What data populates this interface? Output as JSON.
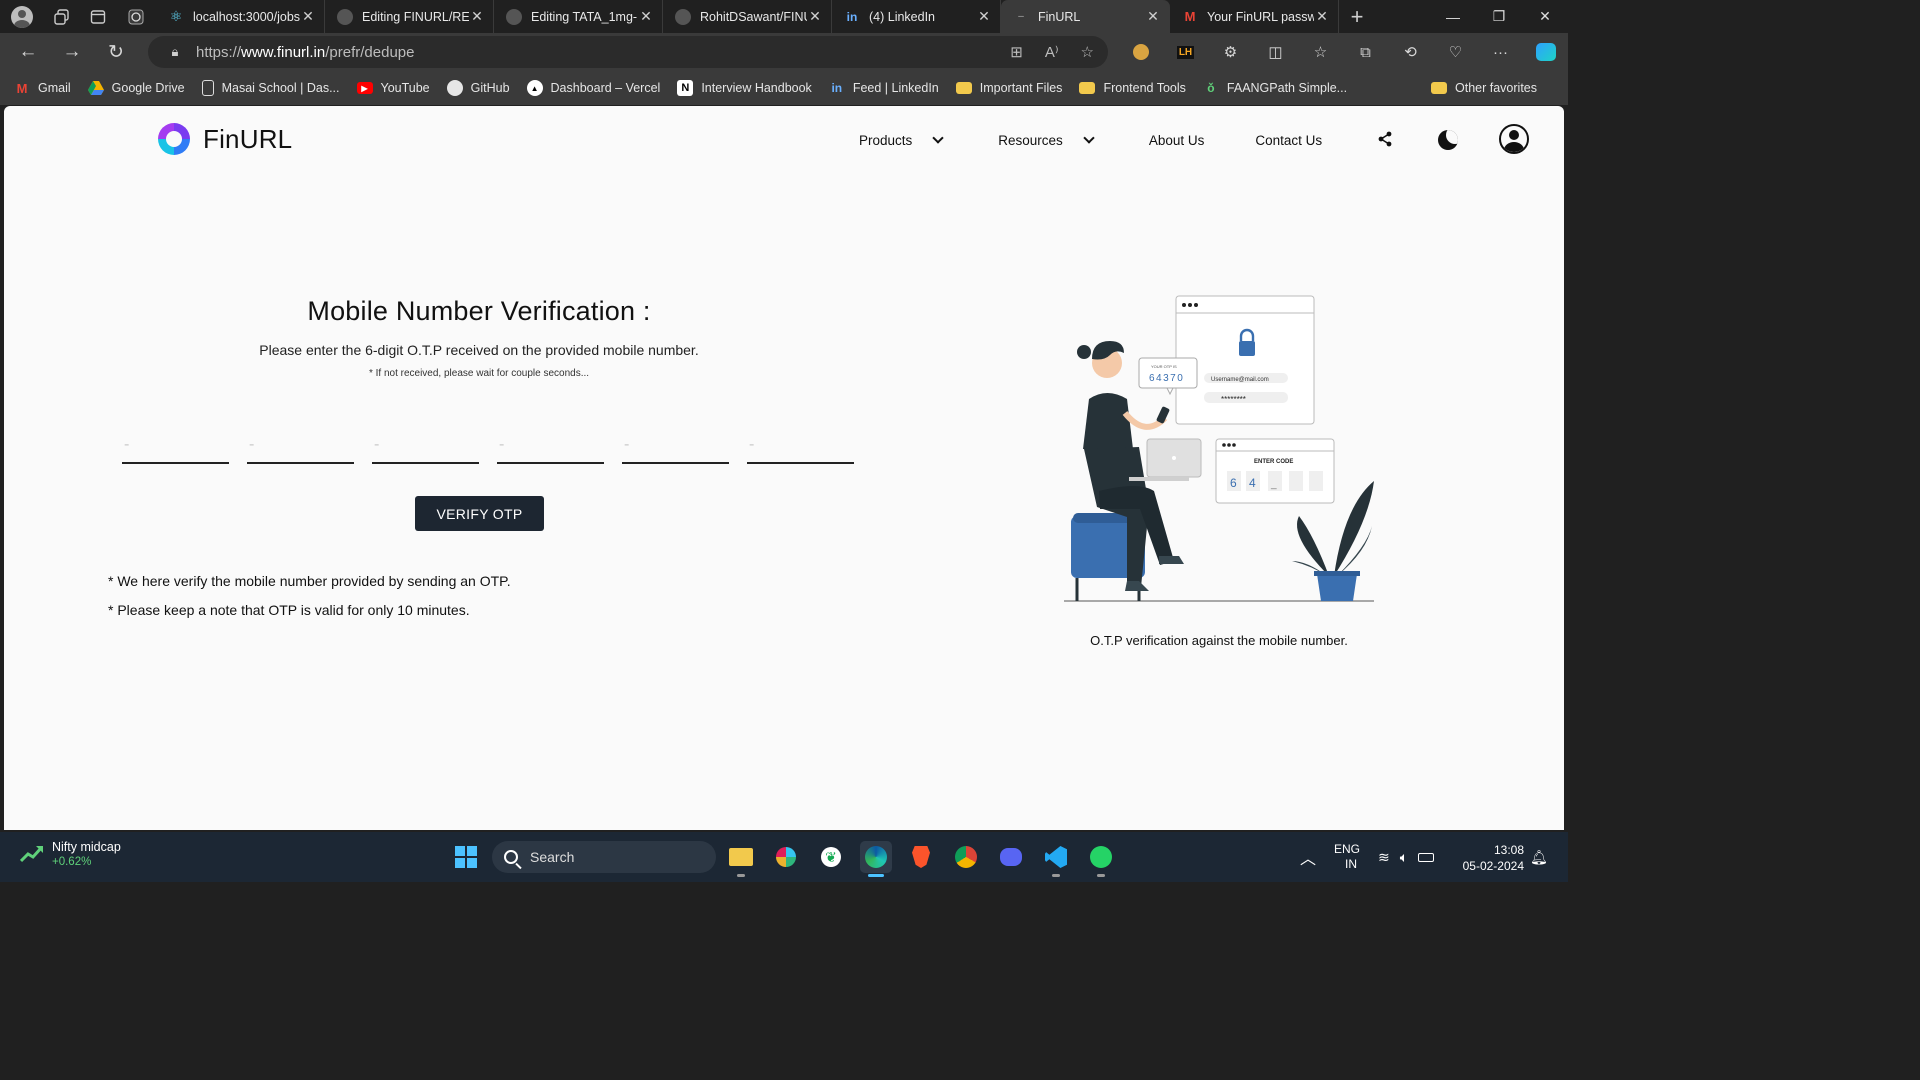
{
  "browser": {
    "tabs": [
      {
        "label": "localhost:3000/jobs",
        "icon": "react-icon",
        "active": false
      },
      {
        "label": "Editing FINURL/README",
        "icon": "github-icon",
        "active": false
      },
      {
        "label": "Editing TATA_1mg-",
        "icon": "github-icon",
        "active": false
      },
      {
        "label": "RohitDSawant/FINURL",
        "icon": "github-icon",
        "active": false
      },
      {
        "label": "(4) LinkedIn",
        "icon": "linkedin-icon",
        "active": false
      },
      {
        "label": "FinURL",
        "icon": "loading-icon",
        "active": true
      },
      {
        "label": "Your FinURL password",
        "icon": "gmail-icon",
        "active": false
      }
    ],
    "address": {
      "prefix": "https://",
      "host": "www.finurl.in",
      "path": "/prefr/dedupe"
    },
    "bookmarks": [
      {
        "label": "Gmail",
        "icon": "gmail-icon"
      },
      {
        "label": "Google Drive",
        "icon": "google-drive-icon"
      },
      {
        "label": "Masai School | Das...",
        "icon": "page-icon"
      },
      {
        "label": "YouTube",
        "icon": "youtube-icon"
      },
      {
        "label": "GitHub",
        "icon": "github-icon"
      },
      {
        "label": "Dashboard – Vercel",
        "icon": "vercel-icon"
      },
      {
        "label": "Interview Handbook",
        "icon": "notion-icon"
      },
      {
        "label": "Feed | LinkedIn",
        "icon": "linkedin-icon"
      },
      {
        "label": "Important Files",
        "icon": "folder-icon"
      },
      {
        "label": "Frontend Tools",
        "icon": "folder-icon"
      },
      {
        "label": "FAANGPath Simple...",
        "icon": "faangpath-icon"
      }
    ],
    "other_favorites": "Other favorites"
  },
  "site": {
    "brand": "FinURL",
    "nav": {
      "products": "Products",
      "resources": "Resources",
      "about": "About Us",
      "contact": "Contact Us"
    },
    "heading": "Mobile Number Verification :",
    "subheading": "Please enter the 6-digit O.T.P received on the provided mobile number.",
    "wait_note": "* If not received, please wait for couple seconds...",
    "otp_placeholder": "-",
    "verify_button": "VERIFY OTP",
    "info_1": "* We here verify the mobile number provided by sending an OTP.",
    "info_2": "* Please keep a note that OTP is valid for only 10 minutes.",
    "illustration": {
      "otp_bubble_title": "YOUR OTP IS",
      "otp_bubble_code": "64370",
      "username": "Username@mail.com",
      "password": "********",
      "enter_code": "ENTER CODE",
      "digit_1": "6",
      "digit_2": "4",
      "digit_3": "_"
    },
    "caption": "O.T.P verification against the mobile number."
  },
  "taskbar": {
    "widget_title": "Nifty midcap",
    "widget_value": "+0.62%",
    "search": "Search",
    "lang_1": "ENG",
    "lang_2": "IN",
    "time": "13:08",
    "date": "05-02-2024"
  },
  "colors": {
    "button_bg": "#1d2631",
    "accent_blue": "#3a6fb0",
    "taskbar": "#1c2734"
  }
}
